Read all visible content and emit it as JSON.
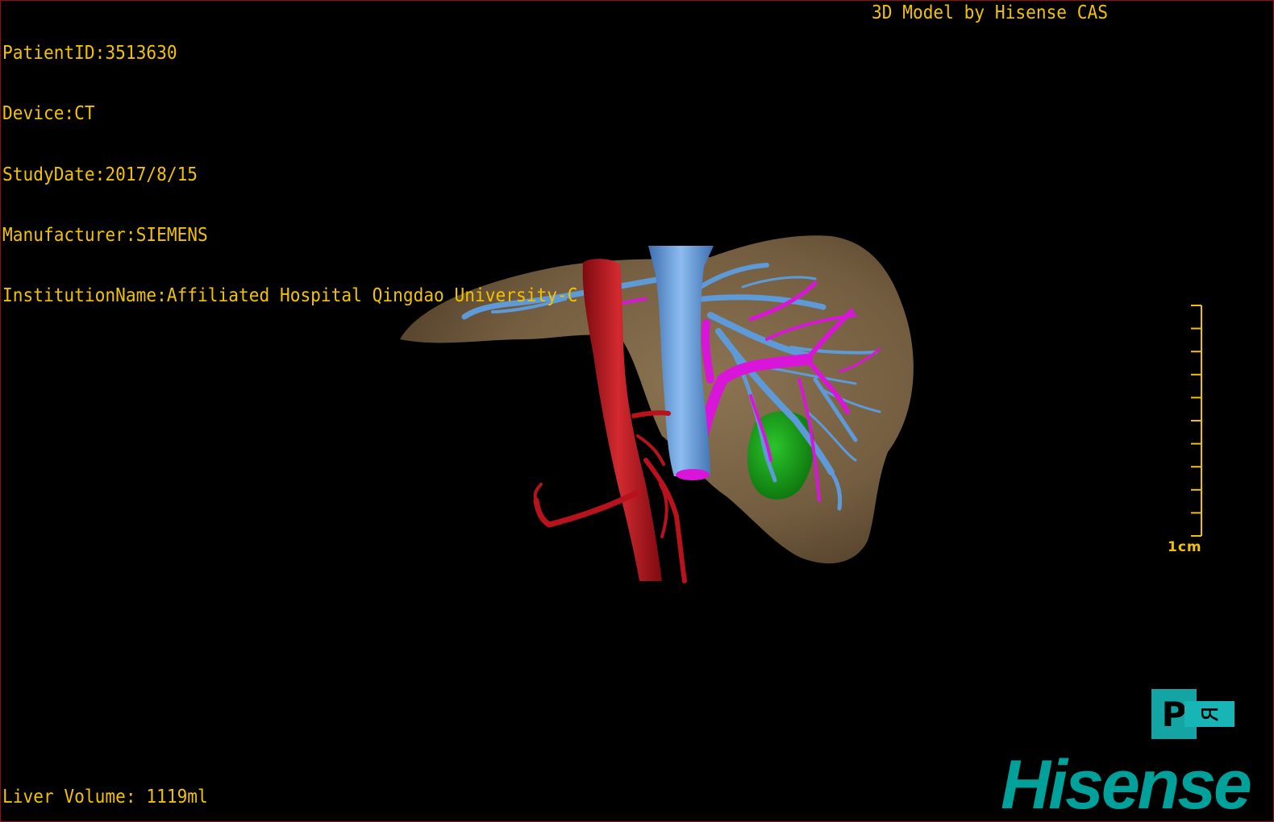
{
  "overlay": {
    "patient_id": "PatientID:3513630",
    "device": "Device:CT",
    "study_date": "StudyDate:2017/8/15",
    "manufacturer": "Manufacturer:SIEMENS",
    "institution": "InstitutionName:Affiliated Hospital Qingdao University-C",
    "model_credit": "3D Model by Hisense CAS",
    "liver_volume": "Liver Volume: 1119ml"
  },
  "scale": {
    "label": "1cm",
    "ticks": 11
  },
  "orientation_cube": {
    "main_face": "P",
    "side_face": "R"
  },
  "brand": {
    "logo_text": "Hisense",
    "color": "#00a19a"
  },
  "colors": {
    "text": "#f2c200",
    "background": "#000000",
    "border": "#8a0f0f",
    "liver": "#7b6445",
    "hepatic_vein": "#5e9ad8",
    "portal_vein": "#d815d8",
    "aorta": "#b8131c",
    "tumor": "#1aa11a"
  },
  "scene": {
    "structures": [
      "liver",
      "hepatic-vein",
      "inferior-vena-cava",
      "portal-vein",
      "aorta",
      "tumor"
    ]
  }
}
